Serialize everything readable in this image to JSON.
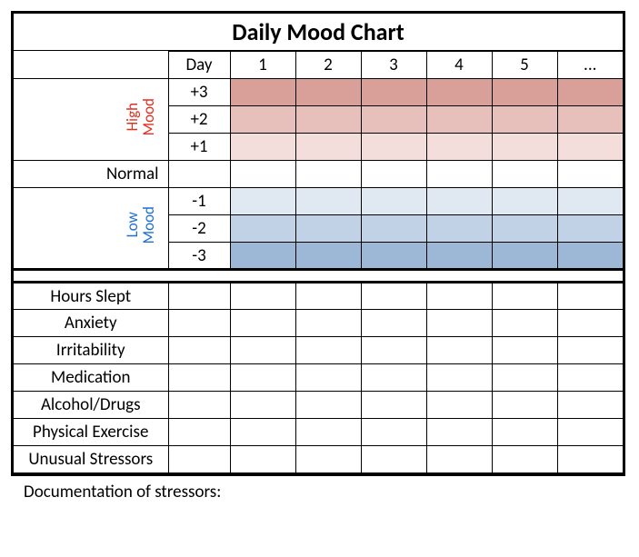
{
  "title": "Daily Mood Chart",
  "header": {
    "day_label": "Day",
    "columns": [
      "1",
      "2",
      "3",
      "4",
      "5",
      "..."
    ]
  },
  "mood": {
    "high_label": "High\nMood",
    "low_label": "Low\nMood",
    "normal_label": "Normal",
    "levels": {
      "p3": "+3",
      "p2": "+2",
      "p1": "+1",
      "m1": "-1",
      "m2": "-2",
      "m3": "-3"
    }
  },
  "trackers": [
    "Hours Slept",
    "Anxiety",
    "Irritability",
    "Medication",
    "Alcohol/Drugs",
    "Physical Exercise",
    "Unusual Stressors"
  ],
  "footer": "Documentation of stressors:",
  "chart_data": {
    "type": "table",
    "title": "Daily Mood Chart",
    "columns": [
      "Day",
      "1",
      "2",
      "3",
      "4",
      "5",
      "..."
    ],
    "mood_scale": [
      "+3",
      "+2",
      "+1",
      "Normal",
      "-1",
      "-2",
      "-3"
    ],
    "mood_colors": {
      "+3": "#d9a09a",
      "+2": "#e7bfbb",
      "+1": "#f3dedc",
      "Normal": "#ffffff",
      "-1": "#e0e8f2",
      "-2": "#c2d2e6",
      "-3": "#9db7d6"
    },
    "tracker_rows": [
      "Hours Slept",
      "Anxiety",
      "Irritability",
      "Medication",
      "Alcohol/Drugs",
      "Physical Exercise",
      "Unusual Stressors"
    ],
    "values": []
  }
}
